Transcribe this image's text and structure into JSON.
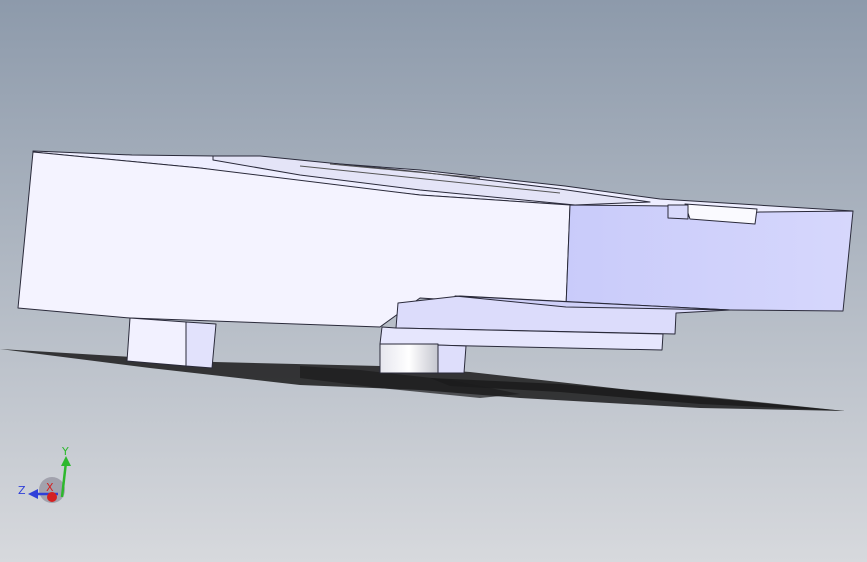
{
  "viewport": {
    "background_top": "#8d9aab",
    "background_bottom": "#d7d9dd",
    "model_face_front": "#f2f1ff",
    "model_face_side": "#cfd0fb",
    "model_edge": "#2a2a3a",
    "shadow": "#1f1f22"
  },
  "triad": {
    "y_label": "Y",
    "z_label": "Z",
    "x_label": "X",
    "y_color": "#2db82d",
    "z_color": "#2f3fd9",
    "x_color": "#d42020"
  }
}
